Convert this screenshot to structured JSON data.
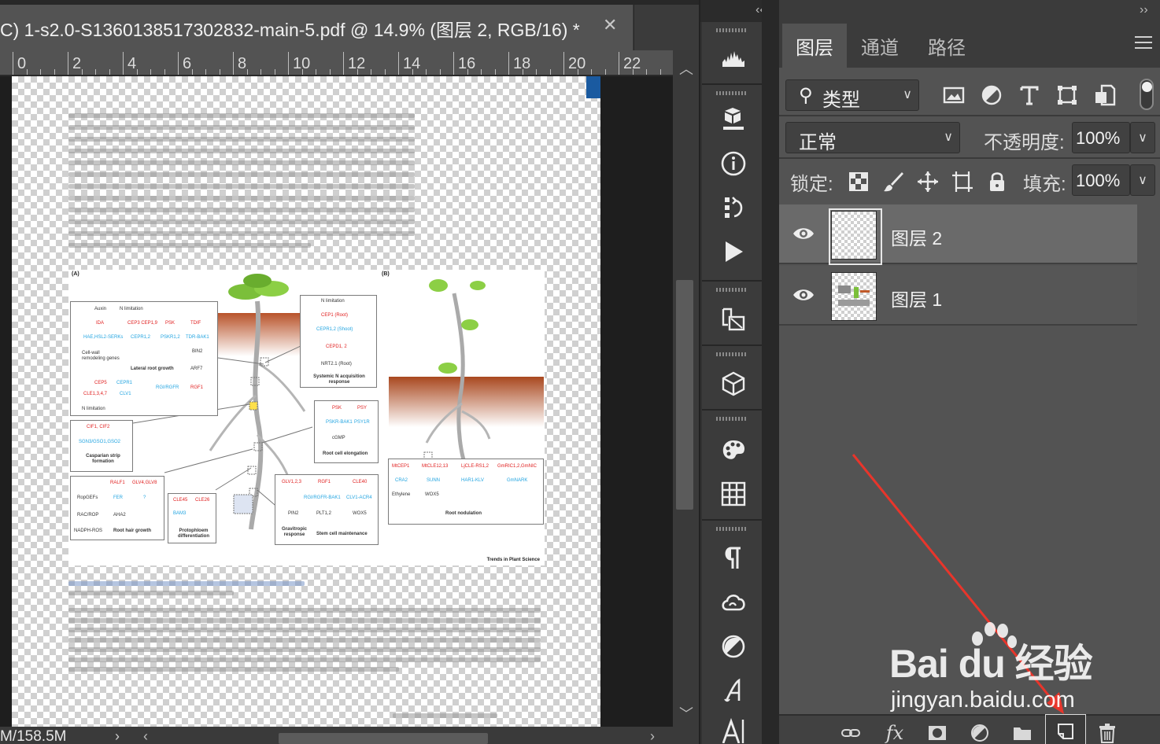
{
  "document": {
    "tab_title": "C) 1-s2.0-S1360138517302832-main-5.pdf @ 14.9% (图层 2, RGB/16) *",
    "close_glyph": "✕",
    "ruler_numbers": [
      "0",
      "2",
      "4",
      "6",
      "8",
      "10",
      "12",
      "14",
      "16",
      "18",
      "20",
      "22"
    ],
    "status_text": "M/158.5M",
    "status_arrow": "›"
  },
  "pdf_page": {
    "figure_panel_a": "(A)",
    "figure_panel_b": "(B)",
    "journal": "Trends in Plant Science",
    "a_labels": [
      "Auxin",
      "N limitation",
      "IDA",
      "CEP3 CEP1,9",
      "PSK",
      "TDIF",
      "HAE,HSL2-SERKs",
      "CEPR1,2",
      "PSKR1,2",
      "TDR-BAK1",
      "BIN2",
      "Cell-wall remodeling genes",
      "Lateral root growth",
      "ARF7",
      "CEP5",
      "CEPR1",
      "CLE1,3,4,7",
      "CLV1",
      "RGI/RGFR",
      "RGF1",
      "N limitation",
      "CIF1, CIF2",
      "SGN3/GSO1,GSO2",
      "Casparian strip formation",
      "RALF1",
      "GLV4,GLV8",
      "RopGEFs",
      "FER",
      "?",
      "RAC/ROP",
      "AHA2",
      "NADPH-ROS",
      "Root hair growth",
      "CLE45",
      "CLE26",
      "BAM3",
      "Protophloem differentiation",
      "GLV1,2,3",
      "RGF1",
      "CLE40",
      "RGI/RGFR-BAK1",
      "CLV1-ACR4",
      "PIN2",
      "PLT1,2",
      "WOX5",
      "Gravitropic response",
      "Stem cell maintenance",
      "N limitation",
      "CEP1 (Root)",
      "CEPR1,2 (Shoot)",
      "CEPD1, 2",
      "NRT2.1 (Root)",
      "Systemic N acquisition response",
      "PSK",
      "PSY",
      "PSKR-BAK1",
      "PSY1R",
      "cGMP",
      "Root cell elongation"
    ],
    "b_labels": [
      "MtCEP1",
      "MtCLE12,13",
      "LjCLE-RS1,2",
      "GmRIC1,2,GmNIC",
      "CRA2",
      "SUNN",
      "HAR1-KLV",
      "GmNARK",
      "Ethylene",
      "WOX5",
      "Root nodulation"
    ]
  },
  "tools": {
    "collapse": "‹‹",
    "items": [
      "histogram-icon",
      "layer-comps-icon",
      "info-icon",
      "history-icon",
      "actions-play-icon",
      "clone-source-icon",
      "3d-cube-icon",
      "color-palette-icon",
      "swatches-grid-icon",
      "paragraph-icon",
      "creative-cloud-icon",
      "adjustments-icon",
      "character-icon",
      "glyphs-icon"
    ]
  },
  "layers_panel": {
    "collapse": "››",
    "tabs": [
      "图层",
      "通道",
      "路径"
    ],
    "filter_label": "类型",
    "blend_mode": "正常",
    "opacity_label": "不透明度:",
    "opacity_value": "100%",
    "lock_label": "锁定:",
    "fill_label": "填充:",
    "fill_value": "100%",
    "layers": [
      {
        "name": "图层 2",
        "visible": true,
        "selected": true
      },
      {
        "name": "图层 1",
        "visible": true,
        "selected": false
      }
    ],
    "bottom_fx": "fx"
  },
  "watermark": {
    "main": "Bai du 经验",
    "url": "jingyan.baidu.com"
  },
  "colors": {
    "panel_bg": "#535353",
    "selected_row": "#6a6a6a",
    "annotation_arrow": "#e8352b",
    "doc_blue_mark": "#1a5aa0"
  }
}
